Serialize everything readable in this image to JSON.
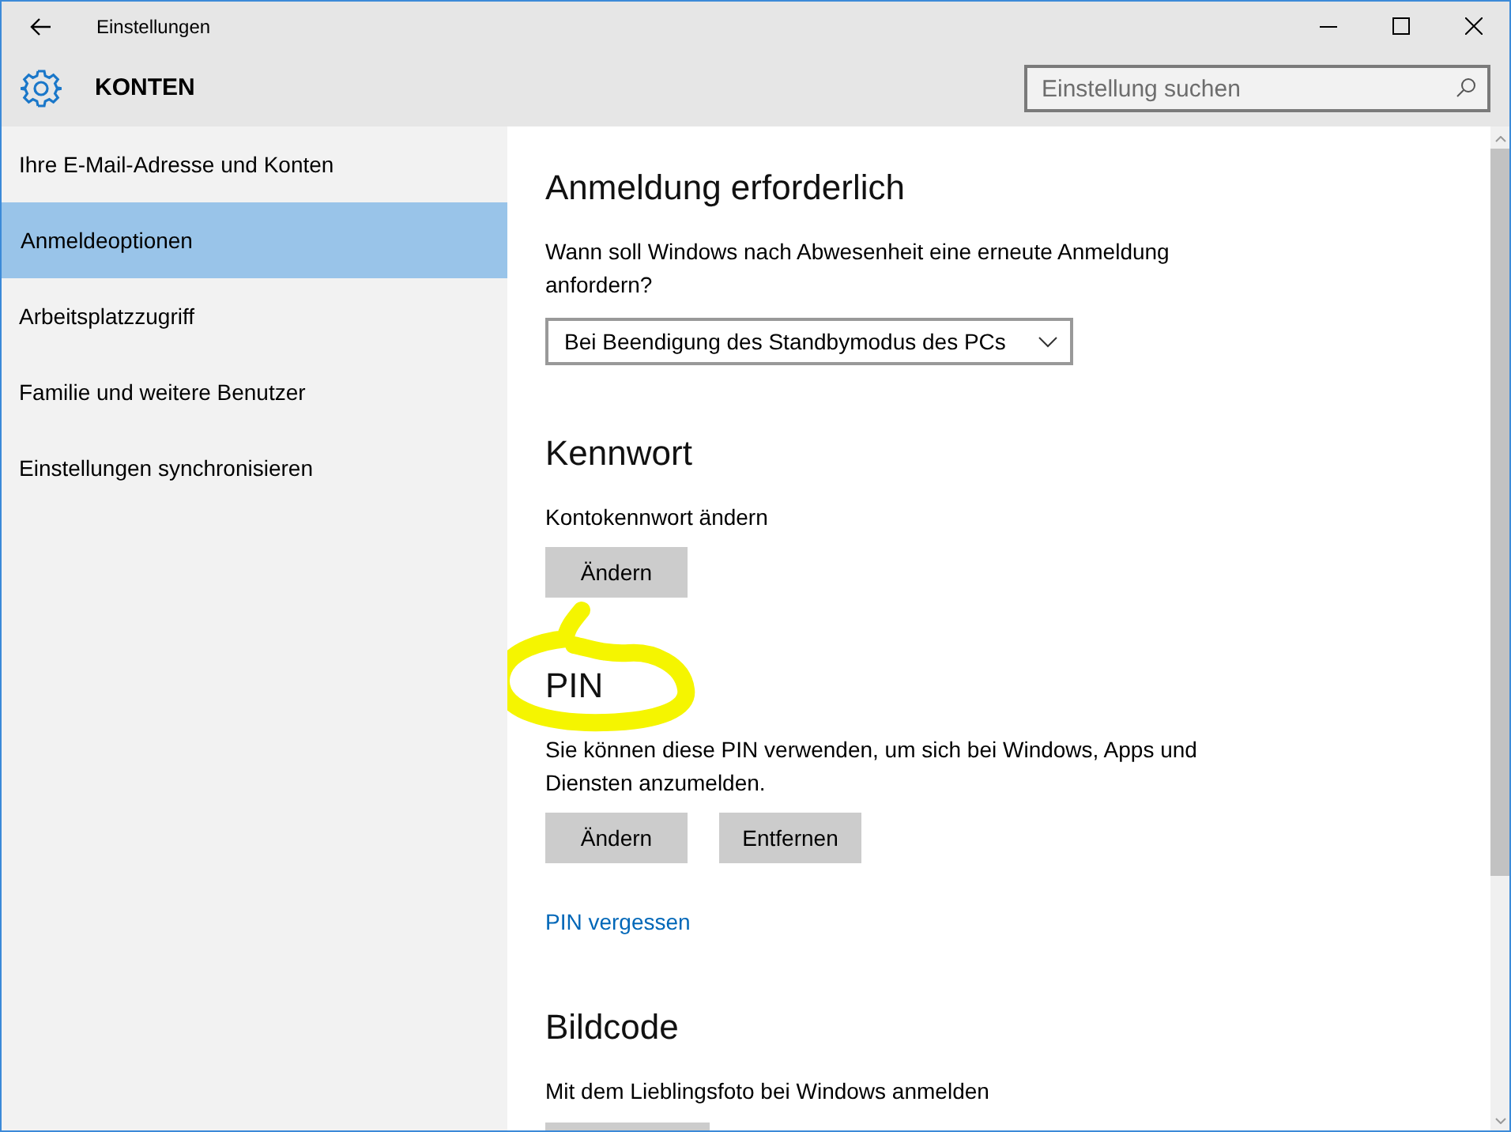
{
  "window": {
    "title": "Einstellungen"
  },
  "header": {
    "title": "KONTEN",
    "search": {
      "placeholder": "Einstellung suchen"
    }
  },
  "sidebar": {
    "items": [
      {
        "label": "Ihre E-Mail-Adresse und Konten",
        "selected": false
      },
      {
        "label": "Anmeldeoptionen",
        "selected": true
      },
      {
        "label": "Arbeitsplatzzugriff",
        "selected": false
      },
      {
        "label": "Familie und weitere Benutzer",
        "selected": false
      },
      {
        "label": "Einstellungen synchronisieren",
        "selected": false
      }
    ]
  },
  "sections": [
    {
      "heading": "Anmeldung erforderlich",
      "items": [
        {
          "kind": "text",
          "text": "Wann soll Windows nach Abwesenheit eine erneute Anmeldung anfordern?"
        },
        {
          "kind": "dropdown",
          "value": "Bei Beendigung des Standbymodus des PCs"
        }
      ]
    },
    {
      "heading": "Kennwort",
      "items": [
        {
          "kind": "text",
          "text": "Kontokennwort ändern"
        },
        {
          "kind": "buttons",
          "buttons": [
            "Ändern"
          ]
        }
      ]
    },
    {
      "heading": "PIN",
      "highlighted": true,
      "items": [
        {
          "kind": "text",
          "text": "Sie können diese PIN verwenden, um sich bei Windows, Apps und Diensten anzumelden."
        },
        {
          "kind": "buttons",
          "buttons": [
            "Ändern",
            "Entfernen"
          ]
        },
        {
          "kind": "link",
          "text": "PIN vergessen"
        }
      ]
    },
    {
      "heading": "Bildcode",
      "items": [
        {
          "kind": "text",
          "text": "Mit dem Lieblingsfoto bei Windows anmelden"
        },
        {
          "kind": "partial_button"
        }
      ]
    }
  ]
}
